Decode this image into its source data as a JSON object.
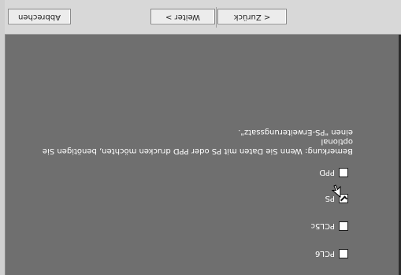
{
  "options": [
    {
      "label": "PCL6",
      "checked": false
    },
    {
      "label": "PCL5c",
      "checked": false
    },
    {
      "label": "PS",
      "checked": true
    },
    {
      "label": "PPD",
      "checked": false
    }
  ],
  "remark": {
    "line1": "Bemerkung: Wenn Sie Daten mit PS oder PPD drucken möchten, benötigen Sie optional",
    "line2": "einen \"PS-Erweiterungssatz\"."
  },
  "buttons": {
    "back": "< Zurück",
    "next": "Weiter >",
    "cancel": "Abbrechen"
  }
}
